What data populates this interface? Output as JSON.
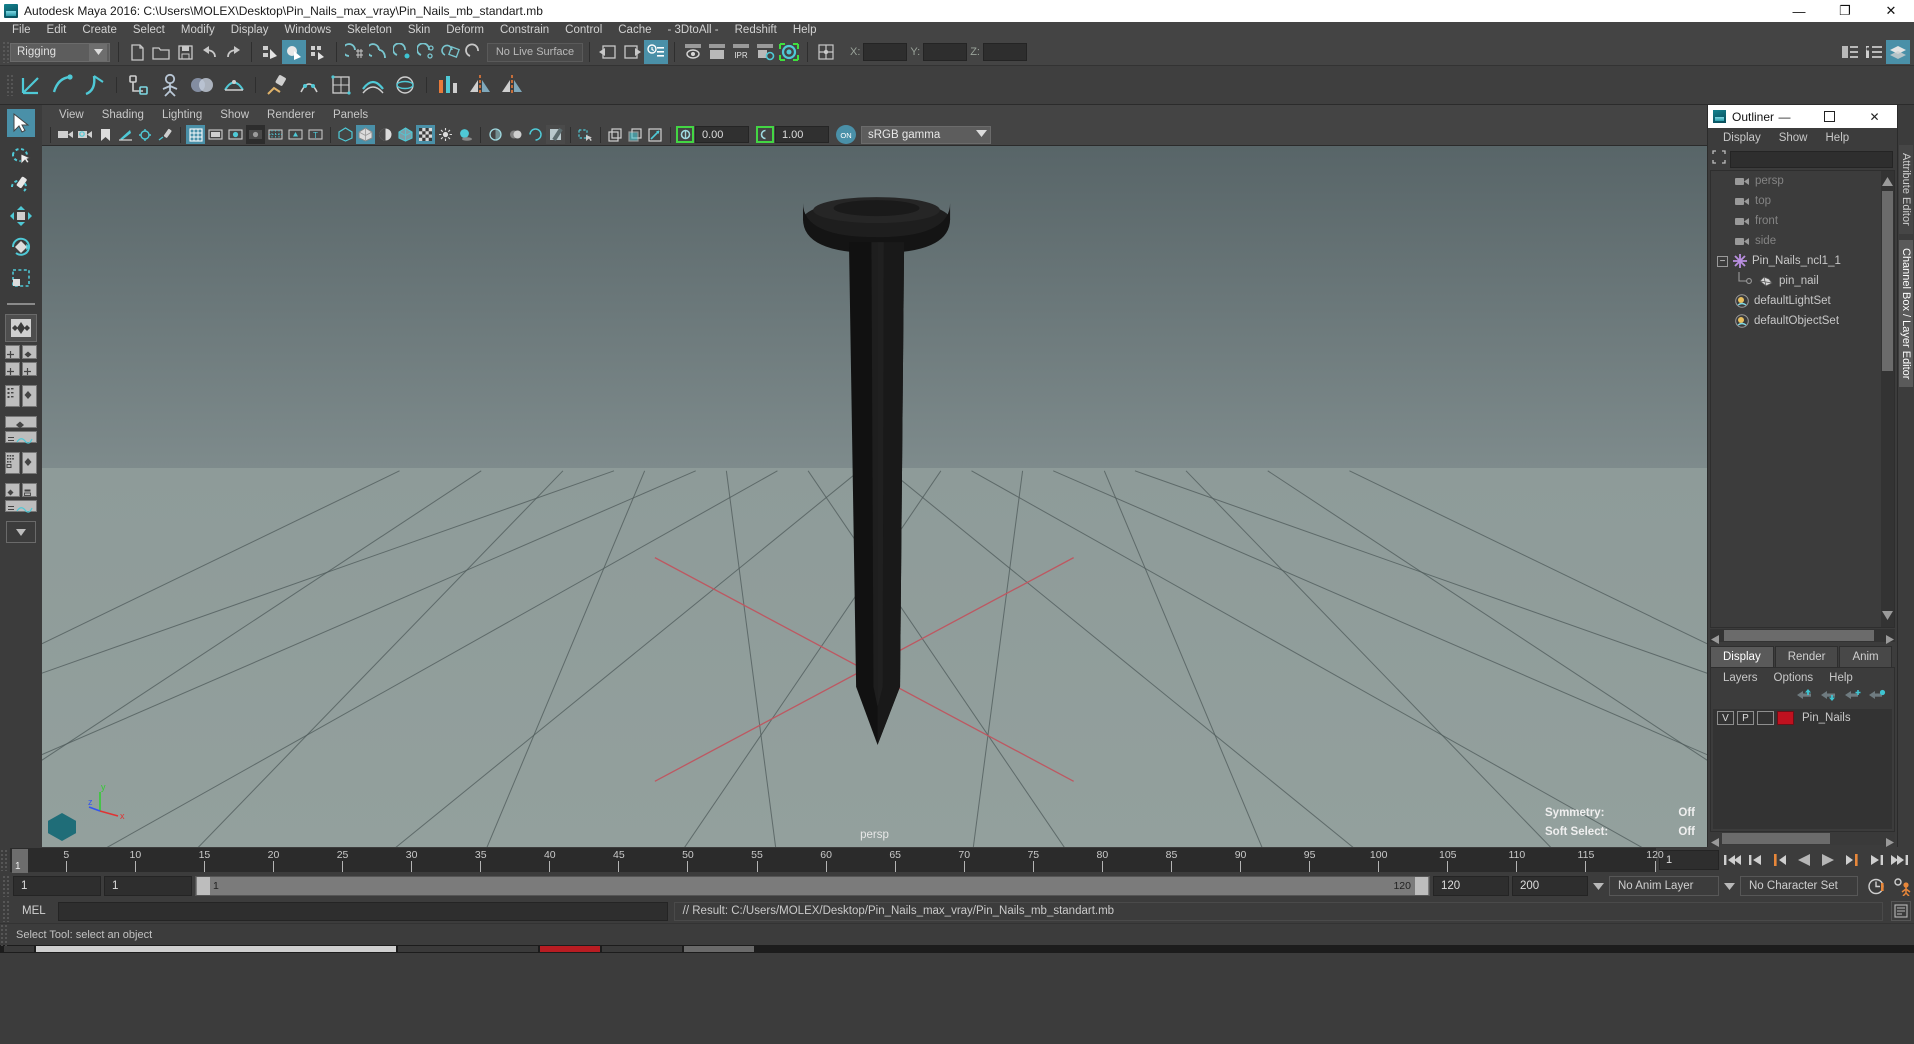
{
  "window": {
    "title": "Autodesk Maya 2016: C:\\Users\\MOLEX\\Desktop\\Pin_Nails_max_vray\\Pin_Nails_mb_standart.mb",
    "minimize": "—",
    "maximize": "❐",
    "close": "✕"
  },
  "menubar": {
    "items": [
      "File",
      "Edit",
      "Create",
      "Select",
      "Modify",
      "Display",
      "Windows",
      "Skeleton",
      "Skin",
      "Deform",
      "Constrain",
      "Control",
      "Cache",
      "- 3DtoAll -",
      "Redshift",
      "Help"
    ]
  },
  "statusline": {
    "menuset": "Rigging",
    "live_surface": "No Live Surface",
    "coord_x_label": "X:",
    "coord_y_label": "Y:",
    "coord_z_label": "Z:",
    "coord_x_value": "",
    "coord_y_value": "",
    "coord_z_value": "",
    "icons": [
      "new-scene-icon",
      "open-scene-icon",
      "save-scene-icon",
      "undo-icon",
      "redo-icon",
      "select-hierarchy-icon",
      "select-object-icon",
      "select-component-icon",
      "snap-to-grid-icon",
      "snap-to-curve-icon",
      "snap-to-point-icon",
      "snap-to-projected-center-icon",
      "snap-to-view-plane-icon",
      "snap-to-live-icon",
      "input-connections-icon",
      "output-connections-icon",
      "construction-history-icon",
      "render-current-frame-icon",
      "ipr-render-icon",
      "render-settings-icon",
      "hypershade-icon",
      "render-view-icon",
      "editor-toggle-icon",
      "show-hide-editor-icon"
    ]
  },
  "shelf": {
    "icons": [
      "joint-tool-icon",
      "ik-handle-tool-icon",
      "ik-spline-handle-icon",
      "create-skeleton-icon",
      "quick-rig-icon",
      "human-ik-icon",
      "skin-bind-icon",
      "paint-skin-weights-icon",
      "cluster-icon",
      "lattice-icon",
      "wire-tool-icon",
      "wrap-icon",
      "blendshape-icon",
      "mirror-icon",
      "pose-icon"
    ]
  },
  "toolbox": {
    "tools": [
      {
        "name": "select-tool",
        "label": "Select Tool",
        "active": true
      },
      {
        "name": "lasso-tool",
        "label": "Lasso Tool",
        "active": false
      },
      {
        "name": "paint-select-tool",
        "label": "Paint Selection Tool",
        "active": false
      },
      {
        "name": "move-tool",
        "label": "Move Tool",
        "active": false
      },
      {
        "name": "rotate-tool",
        "label": "Rotate Tool",
        "active": false
      },
      {
        "name": "scale-tool",
        "label": "Scale Tool",
        "active": false
      }
    ],
    "layouts": [
      "single-perspective-layout",
      "four-view-layout",
      "persp-outliner-layout",
      "persp-graph-layout",
      "persp-hypershade-layout",
      "persp-outliner-graph-layout",
      "more-layouts"
    ]
  },
  "viewport": {
    "menu": [
      "View",
      "Shading",
      "Lighting",
      "Show",
      "Renderer",
      "Panels"
    ],
    "exposure_value": "0.00",
    "gamma_value": "1.00",
    "color_management": "sRGB gamma",
    "camera_label": "persp",
    "symmetry_label": "Symmetry:",
    "symmetry_value": "Off",
    "soft_select_label": "Soft Select:",
    "soft_select_value": "Off",
    "axis_x": "x",
    "axis_y": "y",
    "axis_z": "z",
    "icons": [
      "camera-icon",
      "camera-attributes-icon",
      "bookmark-icon",
      "image-plane-icon",
      "two-d-pan-zoom-icon",
      "grease-pencil-icon",
      "grid-toggle-icon",
      "film-gate-icon",
      "resolution-gate-icon",
      "gate-mask-icon",
      "field-chart-icon",
      "safe-action-icon",
      "safe-title-icon",
      "wireframe-icon",
      "smooth-shade-icon",
      "flat-shade-icon",
      "shaded-wireframe-icon",
      "textured-icon",
      "lighting-icon",
      "shadows-icon",
      "screen-space-ao-icon",
      "motion-blur-icon",
      "multisample-icon",
      "depth-of-field-icon",
      "isolate-select-icon",
      "xray-icon",
      "xray-joints-icon",
      "xray-active-components-icon",
      "exposure-icon",
      "gamma-icon",
      "color-management-toggle-icon"
    ]
  },
  "outliner": {
    "title": "Outliner",
    "menu": [
      "Display",
      "Show",
      "Help"
    ],
    "search_placeholder": "",
    "items": [
      {
        "label": "persp",
        "icon": "camera-icon",
        "dim": true,
        "indent": 1,
        "expander": false
      },
      {
        "label": "top",
        "icon": "camera-icon",
        "dim": true,
        "indent": 1,
        "expander": false
      },
      {
        "label": "front",
        "icon": "camera-icon",
        "dim": true,
        "indent": 1,
        "expander": false
      },
      {
        "label": "side",
        "icon": "camera-icon",
        "dim": true,
        "indent": 1,
        "expander": false
      },
      {
        "label": "Pin_Nails_ncl1_1",
        "icon": "transform-group-icon",
        "dim": false,
        "indent": 1,
        "expander": true
      },
      {
        "label": "pin_nail",
        "icon": "mesh-icon",
        "dim": false,
        "indent": 2,
        "expander": false
      },
      {
        "label": "defaultLightSet",
        "icon": "set-icon",
        "dim": false,
        "indent": 1,
        "expander": false
      },
      {
        "label": "defaultObjectSet",
        "icon": "set-icon",
        "dim": false,
        "indent": 1,
        "expander": false
      }
    ]
  },
  "channel_panel": {
    "tabs": [
      {
        "label": "Display",
        "selected": true
      },
      {
        "label": "Render",
        "selected": false
      },
      {
        "label": "Anim",
        "selected": false
      }
    ],
    "layer_menu": [
      "Layers",
      "Options",
      "Help"
    ],
    "layer_buttons": [
      "move-layer-up-icon",
      "move-layer-down-icon",
      "new-layer-icon",
      "new-layer-from-selected-icon"
    ],
    "layers": [
      {
        "visibility": "V",
        "playback": "P",
        "shading": "",
        "color": "#c0111f",
        "name": "Pin_Nails"
      }
    ]
  },
  "vertical_tabs": [
    {
      "label": "Attribute Editor",
      "selected": false
    },
    {
      "label": "Channel Box / Layer Editor",
      "selected": true
    }
  ],
  "timeslider": {
    "current_frame": "1",
    "ticks": [
      5,
      10,
      15,
      20,
      25,
      30,
      35,
      40,
      45,
      50,
      55,
      60,
      65,
      70,
      75,
      80,
      85,
      90,
      95,
      100,
      105,
      110,
      115,
      120
    ],
    "start": 1,
    "end": 120,
    "playback_buttons": [
      "go-to-start-icon",
      "step-back-frame-icon",
      "step-back-key-icon",
      "play-backwards-icon",
      "play-forwards-icon",
      "step-forward-key-icon",
      "step-forward-frame-icon",
      "go-to-end-icon"
    ]
  },
  "rangeslider": {
    "anim_start": "1",
    "range_start": "1",
    "bar_start": "1",
    "bar_end": "120",
    "range_end": "120",
    "anim_end": "200",
    "anim_layer": "No Anim Layer",
    "character_set": "No Character Set",
    "auto_key_icon": "auto-key-icon",
    "anim_prefs_icon": "animation-preferences-icon"
  },
  "commandline": {
    "mel_label": "MEL",
    "input_value": "",
    "result": "// Result: C:/Users/MOLEX/Desktop/Pin_Nails_max_vray/Pin_Nails_mb_standart.mb"
  },
  "statusbar": {
    "text": "Select Tool: select an object"
  },
  "colors": {
    "accent": "#4a90a8",
    "highlight_green": "#43d643",
    "layer_color": "#c0111f",
    "panel_bg": "#3c3c3c",
    "title_bg": "#ffffff"
  }
}
